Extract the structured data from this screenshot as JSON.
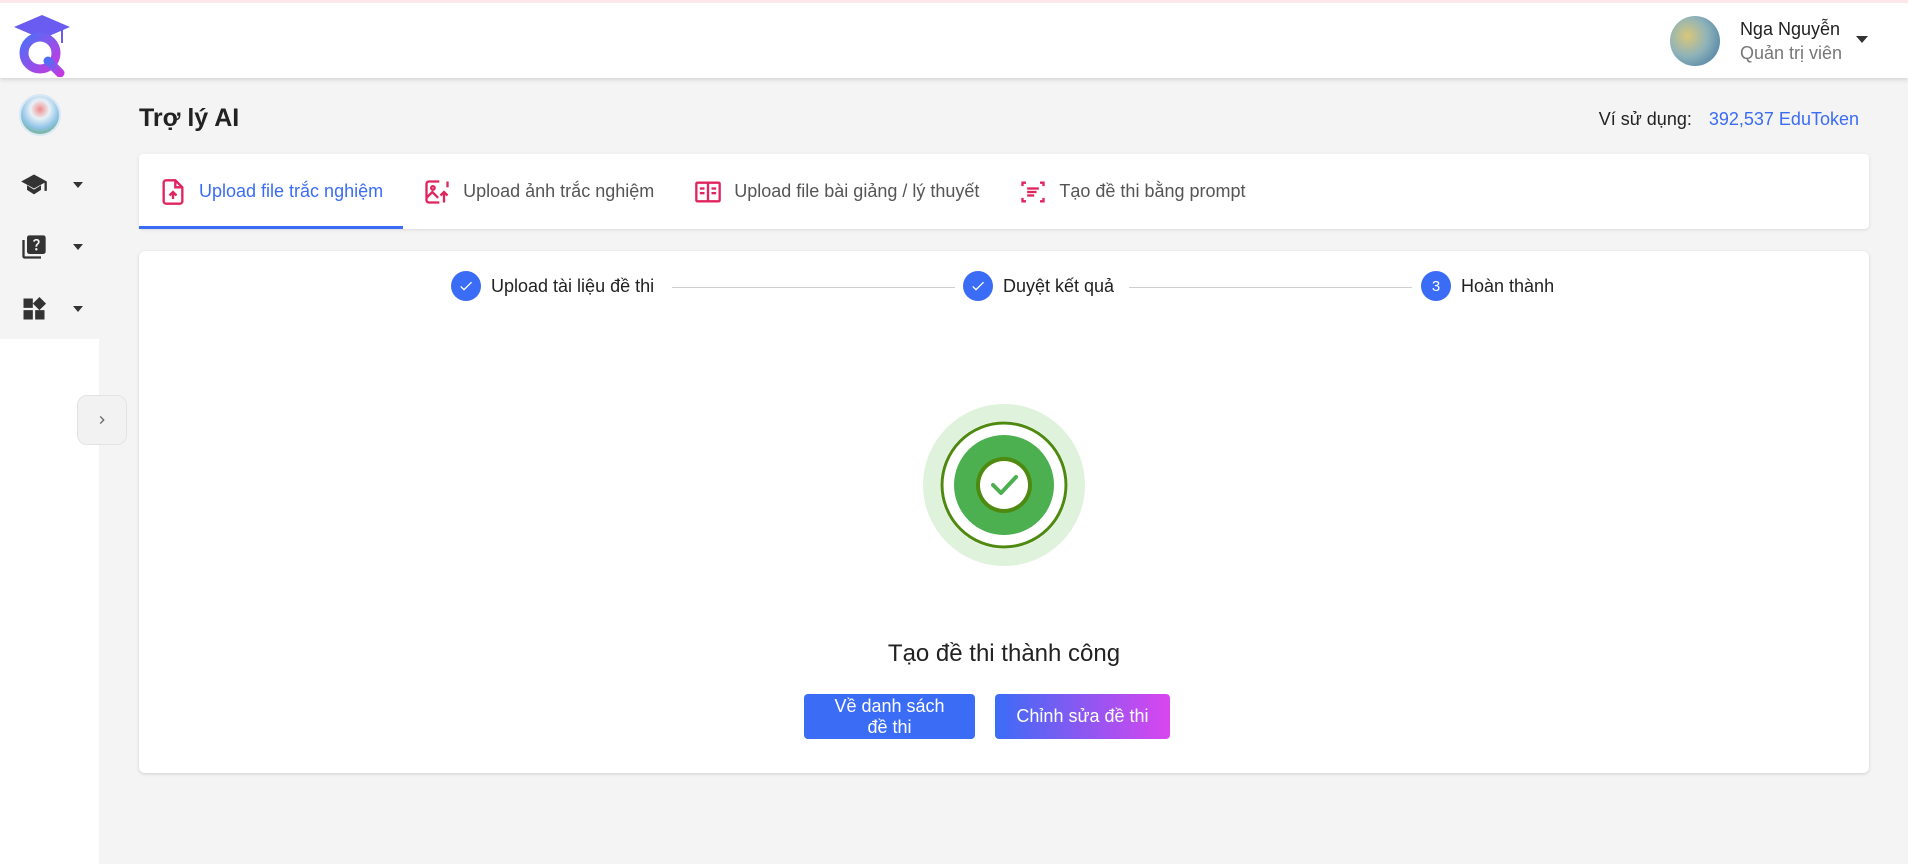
{
  "user": {
    "name": "Nga Nguyễn",
    "role": "Quản trị viên"
  },
  "page": {
    "title": "Trợ lý AI"
  },
  "wallet": {
    "label": "Ví sử dụng:",
    "value": "392,537 EduToken"
  },
  "sidebar": {
    "items": [
      {
        "icon": "graduation-cap-icon"
      },
      {
        "icon": "question-book-icon"
      },
      {
        "icon": "dashboard-icon"
      }
    ]
  },
  "tabs": [
    {
      "label": "Upload file trắc nghiệm",
      "icon": "file-upload-icon",
      "active": true
    },
    {
      "label": "Upload ảnh trắc nghiệm",
      "icon": "image-upload-icon",
      "active": false
    },
    {
      "label": "Upload file bài giảng / lý thuyết",
      "icon": "open-book-icon",
      "active": false
    },
    {
      "label": "Tạo đề thi bằng prompt",
      "icon": "text-scan-icon",
      "active": false
    }
  ],
  "steps": [
    {
      "label": "Upload tài liệu đề thi",
      "status": "done"
    },
    {
      "label": "Duyệt kết quả",
      "status": "done"
    },
    {
      "label": "Hoàn thành",
      "number": "3",
      "status": "current"
    }
  ],
  "result": {
    "message": "Tạo đề thi thành công"
  },
  "buttons": {
    "back_to_list": "Về danh sách đề thi",
    "edit_exam": "Chỉnh sửa đề thi"
  },
  "colors": {
    "accent": "#3b6cf6",
    "tab_icon": "#e0245e",
    "success": "#4caf50"
  }
}
